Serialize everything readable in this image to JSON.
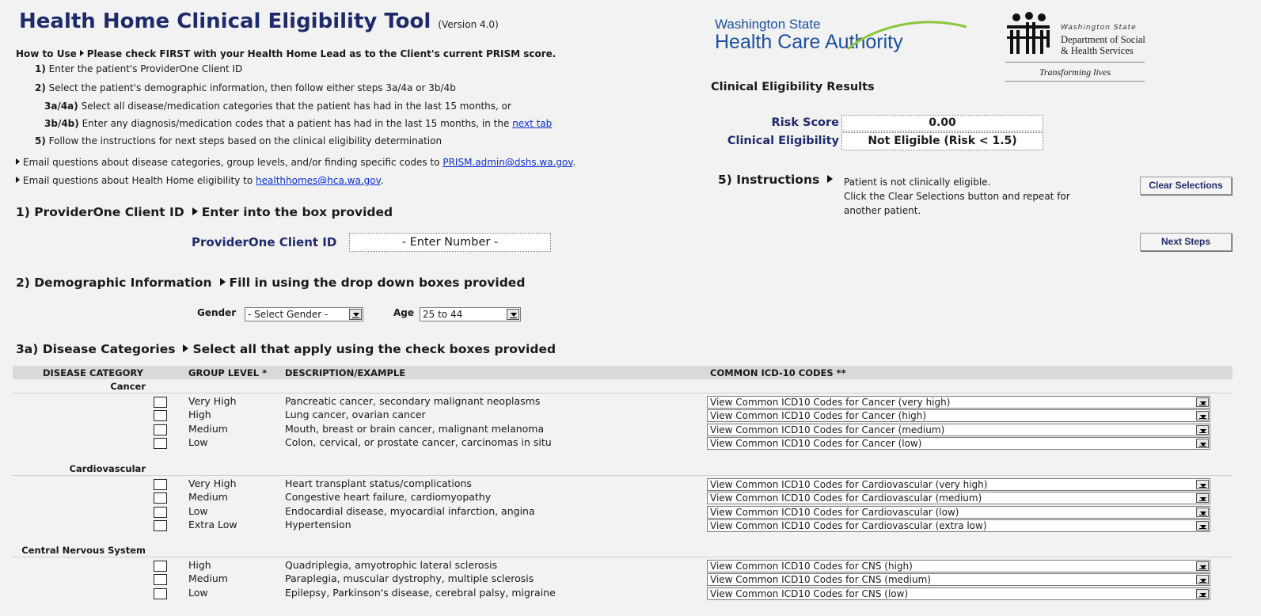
{
  "header": {
    "title": "Health Home Clinical Eligibility Tool",
    "version": "(Version 4.0)"
  },
  "howto": {
    "lead_label": "How to Use",
    "lead_text": "Please check FIRST with your Health Home Lead as to the Client's current PRISM score.",
    "step1_num": "1)",
    "step1_text": "Enter the patient's ProviderOne Client ID",
    "step2_num": "2)",
    "step2_text": "Select the patient's demographic information, then follow either steps 3a/4a or 3b/4b",
    "step3a_num": "3a/4a)",
    "step3a_text": "Select all disease/medication categories that the patient has had in the last 15 months, or",
    "step3b_num": "3b/4b)",
    "step3b_text": "Enter any diagnosis/medication codes that a patient has had in the last 15 months, in the",
    "step3b_link": "next tab",
    "step5_num": "5)",
    "step5_text": "Follow the instructions for next steps based on the clinical eligibility determination",
    "email1_text": "Email questions about disease categories, group levels, and/or finding specific codes  to",
    "email1_link": "PRISM.admin@dshs.wa.gov",
    "email2_text": "Email questions about Health Home eligibility to",
    "email2_link": "healthhomes@hca.wa.gov"
  },
  "logos": {
    "hca_line1": "Washington State",
    "hca_line2a": "Health Care ",
    "hca_line2b": "Authority",
    "dshs_state": "Washington State",
    "dshs_line1": "Department of Social",
    "dshs_line2": "& Health Services",
    "dshs_tagline": "Transforming lives",
    "hca_color": "#1b4fa0",
    "hca_swoosh_color": "#8cc63f"
  },
  "results": {
    "heading": "Clinical Eligibility Results",
    "risk_label": "Risk Score",
    "risk_value": "0.00",
    "eligibility_label": "Clinical Eligibility",
    "eligibility_value": "Not Eligible (Risk < 1.5)"
  },
  "instructions": {
    "heading": "5) Instructions",
    "line1": "Patient is not clinically eligible.",
    "line2": "Click the Clear Selections button and repeat for",
    "line3": "another patient.",
    "clear_button": "Clear Selections",
    "next_button": "Next Steps"
  },
  "section1": {
    "heading": "1) ProviderOne Client ID",
    "hint": "Enter into the box provided",
    "field_label": "ProviderOne Client ID",
    "field_value": "- Enter Number -"
  },
  "section2": {
    "heading": "2) Demographic Information",
    "hint": "Fill in using the drop down boxes provided",
    "gender_label": "Gender",
    "gender_value": "- Select Gender -",
    "age_label": "Age",
    "age_value": "25 to 44"
  },
  "section3a": {
    "heading": "3a) Disease Categories",
    "hint": "Select all that apply using the check boxes provided"
  },
  "table": {
    "col_category": "DISEASE CATEGORY",
    "col_group": "GROUP LEVEL *",
    "col_desc": "DESCRIPTION/EXAMPLE",
    "col_codes": "COMMON ICD-10 CODES **",
    "groups": [
      {
        "name": "Cancer",
        "rows": [
          {
            "level": "Very High",
            "desc": "Pancreatic cancer, secondary malignant neoplasms",
            "codes": "View Common ICD10 Codes for Cancer (very high)"
          },
          {
            "level": "High",
            "desc": "Lung cancer, ovarian cancer",
            "codes": "View Common ICD10 Codes for Cancer (high)"
          },
          {
            "level": "Medium",
            "desc": "Mouth, breast or brain cancer, malignant melanoma",
            "codes": "View Common ICD10 Codes for Cancer (medium)"
          },
          {
            "level": "Low",
            "desc": "Colon, cervical, or prostate cancer, carcinomas in situ",
            "codes": "View Common ICD10 Codes for Cancer (low)"
          }
        ]
      },
      {
        "name": "Cardiovascular",
        "rows": [
          {
            "level": "Very High",
            "desc": "Heart transplant status/complications",
            "codes": "View Common ICD10 Codes for Cardiovascular (very high)"
          },
          {
            "level": "Medium",
            "desc": "Congestive heart failure, cardiomyopathy",
            "codes": "View Common ICD10 Codes for Cardiovascular (medium)"
          },
          {
            "level": "Low",
            "desc": "Endocardial disease, myocardial infarction, angina",
            "codes": "View Common ICD10 Codes for Cardiovascular (low)"
          },
          {
            "level": "Extra Low",
            "desc": "Hypertension",
            "codes": "View Common ICD10 Codes for Cardiovascular (extra low)"
          }
        ]
      },
      {
        "name": "Central Nervous System",
        "rows": [
          {
            "level": "High",
            "desc": "Quadriplegia, amyotrophic lateral sclerosis",
            "codes": "View Common ICD10 Codes for CNS (high)"
          },
          {
            "level": "Medium",
            "desc": "Paraplegia, muscular dystrophy, multiple sclerosis",
            "codes": "View Common ICD10 Codes for CNS (medium)"
          },
          {
            "level": "Low",
            "desc": "Epilepsy, Parkinson's disease, cerebral palsy, migraine",
            "codes": "View Common ICD10 Codes for CNS (low)"
          }
        ]
      }
    ]
  }
}
